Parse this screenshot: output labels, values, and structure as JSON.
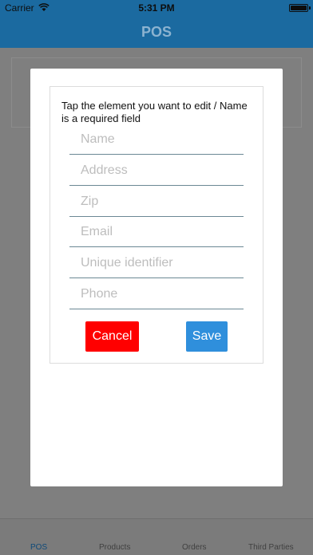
{
  "status_bar": {
    "carrier": "Carrier",
    "time": "5:31 PM",
    "wifi_icon": "wifi-icon",
    "battery_icon": "battery-icon"
  },
  "nav": {
    "title": "POS"
  },
  "colors": {
    "nav_blue": "#1b6aa0",
    "cancel_red": "#ff0000",
    "save_blue": "#2f8fdc"
  },
  "modal": {
    "instruction": "Tap the element you want to edit / Name is a required field",
    "fields": {
      "name": {
        "placeholder": "Name",
        "value": ""
      },
      "address": {
        "placeholder": "Address",
        "value": ""
      },
      "zip": {
        "placeholder": "Zip",
        "value": ""
      },
      "email": {
        "placeholder": "Email",
        "value": ""
      },
      "unique_id": {
        "placeholder": "Unique identifier",
        "value": ""
      },
      "phone": {
        "placeholder": "Phone",
        "value": ""
      }
    },
    "cancel_label": "Cancel",
    "save_label": "Save"
  },
  "tabs": [
    {
      "label": "POS",
      "active": true
    },
    {
      "label": "Products",
      "active": false
    },
    {
      "label": "Orders",
      "active": false
    },
    {
      "label": "Third Parties",
      "active": false
    }
  ]
}
